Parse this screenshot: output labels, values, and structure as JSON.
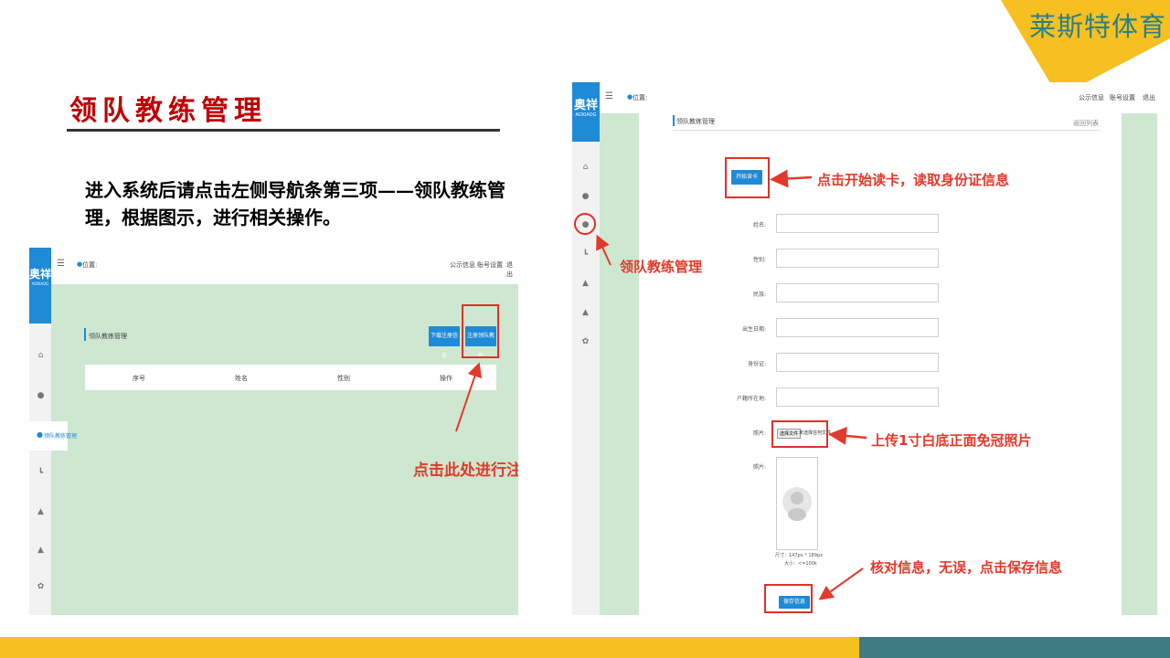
{
  "brand": {
    "name": "莱斯特体育",
    "tri_color": "#f6c021",
    "text_color": "#2c7f86"
  },
  "slide": {
    "title": "领队教练管理",
    "instructions": "进入系统后请点击左侧导航条第三项——领队教练管理，根据图示，进行相关操作。"
  },
  "shot1": {
    "logo": {
      "main": "奥祥",
      "sub": "AOXIAOG"
    },
    "header": {
      "menu_icon": "☰",
      "location": "位置:",
      "actions": [
        "公示信息",
        "账号设置",
        "退出"
      ]
    },
    "sidebar_active": "领队教练管理",
    "panel_title": "领队教练管理",
    "buttons": {
      "download": "下载注册信息",
      "register": "注册领队教练"
    },
    "table_headers": [
      "序号",
      "姓名",
      "性别",
      "操作"
    ],
    "annotation": "点击此处进行注册"
  },
  "shot2": {
    "logo": {
      "main": "奥祥",
      "sub": "AOXIAOG"
    },
    "header": {
      "menu_icon": "☰",
      "location": "位置:",
      "actions": [
        "公示信息",
        "账号设置",
        "退出"
      ]
    },
    "panel_title": "领队教练管理",
    "back_link": "返回列表",
    "read_card_button": "开始读卡",
    "fields": [
      {
        "label": "姓名:"
      },
      {
        "label": "性别:"
      },
      {
        "label": "民族:"
      },
      {
        "label": "出生日期:"
      },
      {
        "label": "身份证:"
      },
      {
        "label": "户籍所在地:"
      }
    ],
    "photo_label": "照片:",
    "choose_file_button": "选择文件",
    "no_file_text": "未选择任何文件",
    "photo_preview_label": "照片:",
    "photo_hint_size": "尺寸：147px * 189px",
    "photo_hint_weight": "大小：<=100k",
    "save_button": "保存信息",
    "annotations": {
      "read_card": "点击开始读卡，读取身份证信息",
      "nav": "领队教练管理",
      "upload": "上传1寸白底正面免冠照片",
      "save": "核对信息，无误，点击保存信息"
    }
  },
  "colors": {
    "accent_red": "#e23a2a",
    "brand_blue": "#1f8ad6",
    "content_green": "#cde7d1",
    "bar_yellow": "#f6c021",
    "bar_teal": "#3d7c82"
  }
}
